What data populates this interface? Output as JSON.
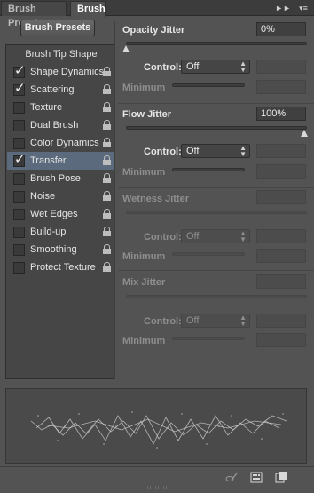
{
  "tabs": {
    "presets_label": "Brush Presets",
    "brush_label": "Brush",
    "collapse_glyph": "►►",
    "menu_glyph": "▾≡"
  },
  "sidebar": {
    "presets_button": "Brush Presets",
    "header": "Brush Tip Shape",
    "items": [
      {
        "label": "Shape Dynamics",
        "checked": true
      },
      {
        "label": "Scattering",
        "checked": true
      },
      {
        "label": "Texture",
        "checked": false
      },
      {
        "label": "Dual Brush",
        "checked": false
      },
      {
        "label": "Color Dynamics",
        "checked": false
      },
      {
        "label": "Transfer",
        "checked": true,
        "selected": true
      },
      {
        "label": "Brush Pose",
        "checked": false
      },
      {
        "label": "Noise",
        "checked": false
      },
      {
        "label": "Wet Edges",
        "checked": false
      },
      {
        "label": "Build-up",
        "checked": false
      },
      {
        "label": "Smoothing",
        "checked": false
      },
      {
        "label": "Protect Texture",
        "checked": false
      }
    ],
    "check_glyph": "✓"
  },
  "settings": {
    "opacity": {
      "label": "Opacity Jitter",
      "value": "0%",
      "slider_fraction": 0.0,
      "control_label": "Control:",
      "control_value": "Off",
      "minimum_label": "Minimum"
    },
    "flow": {
      "label": "Flow Jitter",
      "value": "100%",
      "slider_fraction": 1.0,
      "control_label": "Control:",
      "control_value": "Off",
      "minimum_label": "Minimum"
    },
    "wetness": {
      "label": "Wetness Jitter",
      "control_label": "Control:",
      "control_value": "Off",
      "minimum_label": "Minimum"
    },
    "mix": {
      "label": "Mix Jitter",
      "control_label": "Control:",
      "control_value": "Off",
      "minimum_label": "Minimum"
    }
  },
  "bottom_icons": [
    "brush-toggle-icon",
    "grid-icon",
    "new-preset-icon"
  ],
  "colors": {
    "selected": "#5b6a7c",
    "panel": "#535353"
  }
}
